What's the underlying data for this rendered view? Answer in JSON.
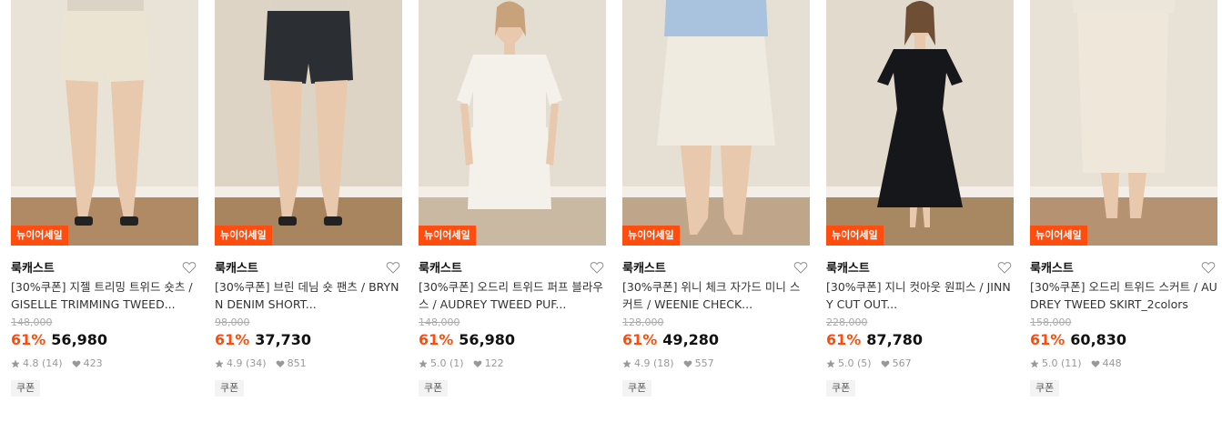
{
  "products": [
    {
      "badge": "뉴이어세일",
      "brand": "룩캐스트",
      "title": "[30%쿠폰] 지젤 트리밍 트위드 숏츠 / GISELLE TRIMMING TWEED...",
      "original_price": "148,000",
      "discount": "61%",
      "price": "56,980",
      "rating": "4.8 (14)",
      "likes": "423",
      "tag": "쿠폰",
      "image": {
        "bg": "#e9e2d6",
        "garment": "#ece4d2",
        "garment_type": "shorts",
        "floor": "#b08a64"
      }
    },
    {
      "badge": "뉴이어세일",
      "brand": "룩캐스트",
      "title": "[30%쿠폰] 브린 데님 숏 팬츠 / BRYNN DENIM SHORT...",
      "original_price": "98,000",
      "discount": "61%",
      "price": "37,730",
      "rating": "4.9 (34)",
      "likes": "851",
      "tag": "쿠폰",
      "image": {
        "bg": "#ddd4c6",
        "garment": "#2b2f33",
        "garment_type": "shorts",
        "floor": "#a8845f"
      }
    },
    {
      "badge": "뉴이어세일",
      "brand": "룩캐스트",
      "title": "[30%쿠폰] 오드리 트위드 퍼프 블라우스 / AUDREY TWEED PUF...",
      "original_price": "148,000",
      "discount": "61%",
      "price": "56,980",
      "rating": "5.0 (1)",
      "likes": "122",
      "tag": "쿠폰",
      "image": {
        "bg": "#e4ddd2",
        "garment": "#f4f1ea",
        "garment_type": "set",
        "floor": "#c9b9a3"
      }
    },
    {
      "badge": "뉴이어세일",
      "brand": "룩캐스트",
      "title": "[30%쿠폰] 위니 체크 자가드 미니 스커트 / WEENIE CHECK...",
      "original_price": "128,000",
      "discount": "61%",
      "price": "49,280",
      "rating": "4.9 (18)",
      "likes": "557",
      "tag": "쿠폰",
      "image": {
        "bg": "#e6dfd4",
        "garment": "#f0ebe0",
        "garment_type": "skirt",
        "floor": "#bfa68a"
      }
    },
    {
      "badge": "뉴이어세일",
      "brand": "룩캐스트",
      "title": "[30%쿠폰] 지니 컷아웃 원피스 / JINNY CUT OUT...",
      "original_price": "228,000",
      "discount": "61%",
      "price": "87,780",
      "rating": "5.0 (5)",
      "likes": "567",
      "tag": "쿠폰",
      "image": {
        "bg": "#e2dacd",
        "garment": "#15171a",
        "garment_type": "dress",
        "floor": "#a88763"
      }
    },
    {
      "badge": "뉴이어세일",
      "brand": "룩캐스트",
      "title": "[30%쿠폰] 오드리 트위드 스커트 / AUDREY TWEED SKIRT_2colors",
      "original_price": "158,000",
      "discount": "61%",
      "price": "60,830",
      "rating": "5.0 (11)",
      "likes": "448",
      "tag": "쿠폰",
      "image": {
        "bg": "#e8e1d5",
        "garment": "#efe8da",
        "garment_type": "long-skirt",
        "floor": "#b59272"
      }
    }
  ]
}
